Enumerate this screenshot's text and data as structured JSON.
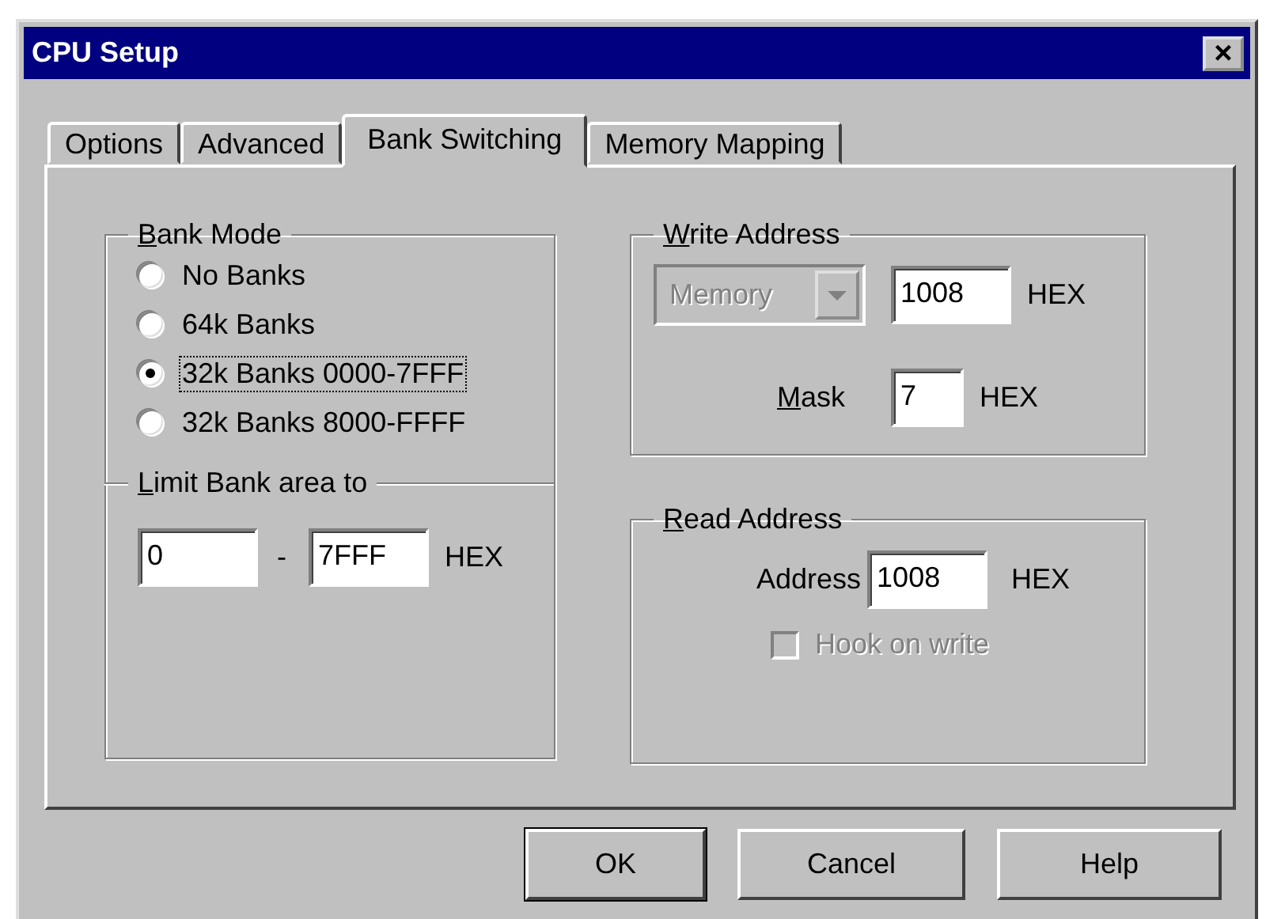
{
  "window": {
    "title": "CPU Setup",
    "close": "×"
  },
  "tabs": [
    {
      "label": "Options",
      "selected": false
    },
    {
      "label": "Advanced",
      "selected": false
    },
    {
      "label": "Bank Switching",
      "selected": true
    },
    {
      "label": "Memory Mapping",
      "selected": false
    }
  ],
  "bank_mode": {
    "label": "Bank Mode",
    "mnemonic": true,
    "options": [
      {
        "label": "No Banks",
        "selected": false,
        "focused": false
      },
      {
        "label": "64k Banks",
        "selected": false,
        "focused": false
      },
      {
        "label": "32k Banks 0000-7FFF",
        "selected": true,
        "focused": true
      },
      {
        "label": "32k Banks 8000-FFFF",
        "selected": false,
        "focused": false
      }
    ]
  },
  "limit_bank_area": {
    "label": "Limit Bank area to",
    "mnemonic": true,
    "from": "0",
    "separator": "-",
    "to": "7FFF",
    "unit": "HEX"
  },
  "write_address": {
    "label": "Write Address",
    "mnemonic": true,
    "combo": {
      "value": "Memory",
      "disabled": true
    },
    "address": "1008",
    "unit": "HEX",
    "mask_label": "Mask",
    "mask_mnemonic": true,
    "mask": "7",
    "mask_unit": "HEX"
  },
  "read_address": {
    "label": "Read Address",
    "mnemonic": true,
    "address_label": "Address",
    "address": "1008",
    "unit": "HEX",
    "checkbox": {
      "label": "Hook on write",
      "checked": false,
      "disabled": true
    }
  },
  "buttons": [
    {
      "label": "OK",
      "default": true
    },
    {
      "label": "Cancel",
      "default": false
    },
    {
      "label": "Help",
      "default": false
    }
  ]
}
